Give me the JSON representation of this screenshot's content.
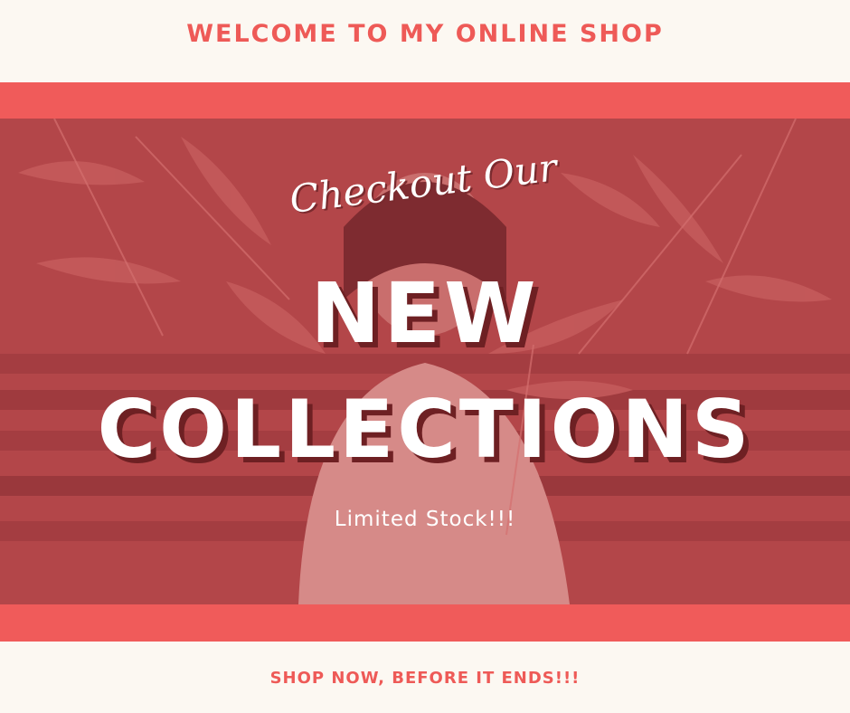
{
  "header": {
    "title": "WELCOME TO MY ONLINE SHOP"
  },
  "hero": {
    "script_text": "Checkout Our",
    "headline_line1": "NEW",
    "headline_line2": "COLLECTIONS",
    "subtext": "Limited Stock!!!"
  },
  "footer": {
    "cta": "SHOP NOW, BEFORE IT ENDS!!!"
  },
  "colors": {
    "accent": "#f05b5a",
    "background": "#fcf8f2",
    "overlay": "#b94a4d"
  }
}
